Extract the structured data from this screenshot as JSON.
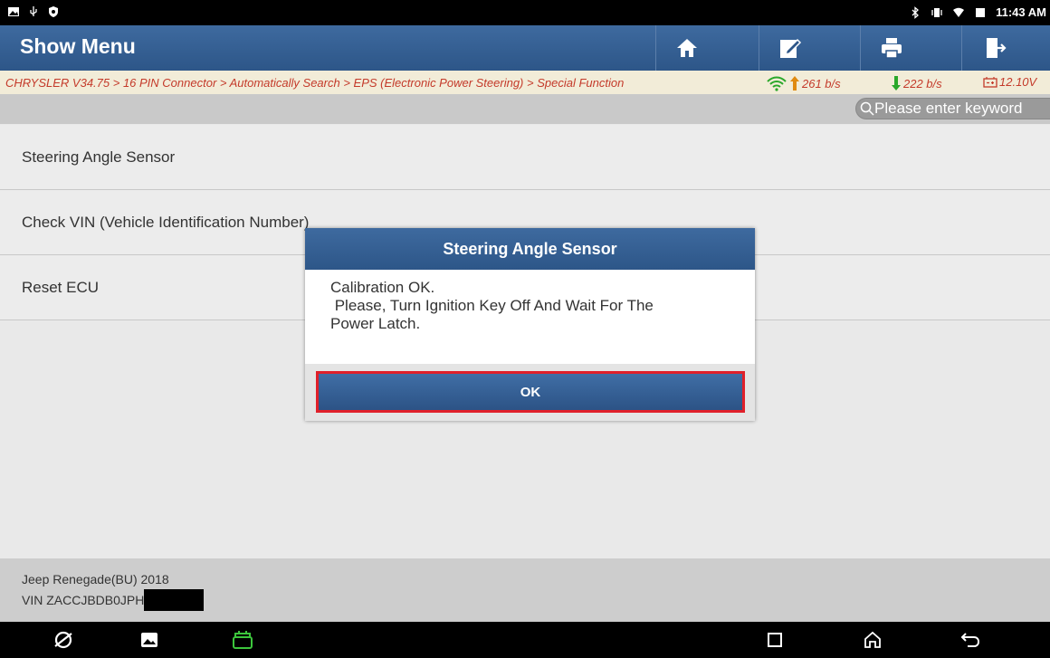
{
  "status_bar": {
    "time": "11:43 AM",
    "left_icons": [
      "image-icon",
      "usb-icon",
      "shield-icon"
    ],
    "right_icons": [
      "bluetooth-icon",
      "vibrate-icon",
      "wifi-icon",
      "battery-icon"
    ]
  },
  "header": {
    "title": "Show Menu",
    "buttons": [
      "home-icon",
      "edit-report-icon",
      "print-icon",
      "exit-icon"
    ]
  },
  "breadcrumb": {
    "path": "CHRYSLER V34.75 > 16 PIN Connector > Automatically Search > EPS (Electronic Power Steering) > Special Function",
    "upload": "261 b/s",
    "download": "222 b/s",
    "voltage": "12.10V"
  },
  "search": {
    "placeholder": "Please enter keyword"
  },
  "menu": {
    "items": [
      "Steering Angle Sensor",
      "Check VIN (Vehicle Identification Number)",
      "Reset ECU"
    ]
  },
  "footer": {
    "vehicle": "Jeep Renegade(BU) 2018",
    "vin": "VIN ZACCJBDB0JPH"
  },
  "dialog": {
    "title": "Steering Angle Sensor",
    "lines": [
      "Calibration OK.",
      " Please, Turn Ignition Key Off And Wait For The",
      "Power Latch."
    ],
    "ok_label": "OK"
  },
  "colors": {
    "header_blue": "#2d5688",
    "crumb_red": "#c43a2a",
    "highlight_red": "#e0202a",
    "wifi_green": "#2aa82a",
    "up_orange": "#e08a10"
  },
  "nav_bar": {
    "icons": [
      "browser-icon",
      "gallery-icon",
      "vci-icon",
      "recents-icon",
      "home-nav-icon",
      "back-icon"
    ]
  }
}
